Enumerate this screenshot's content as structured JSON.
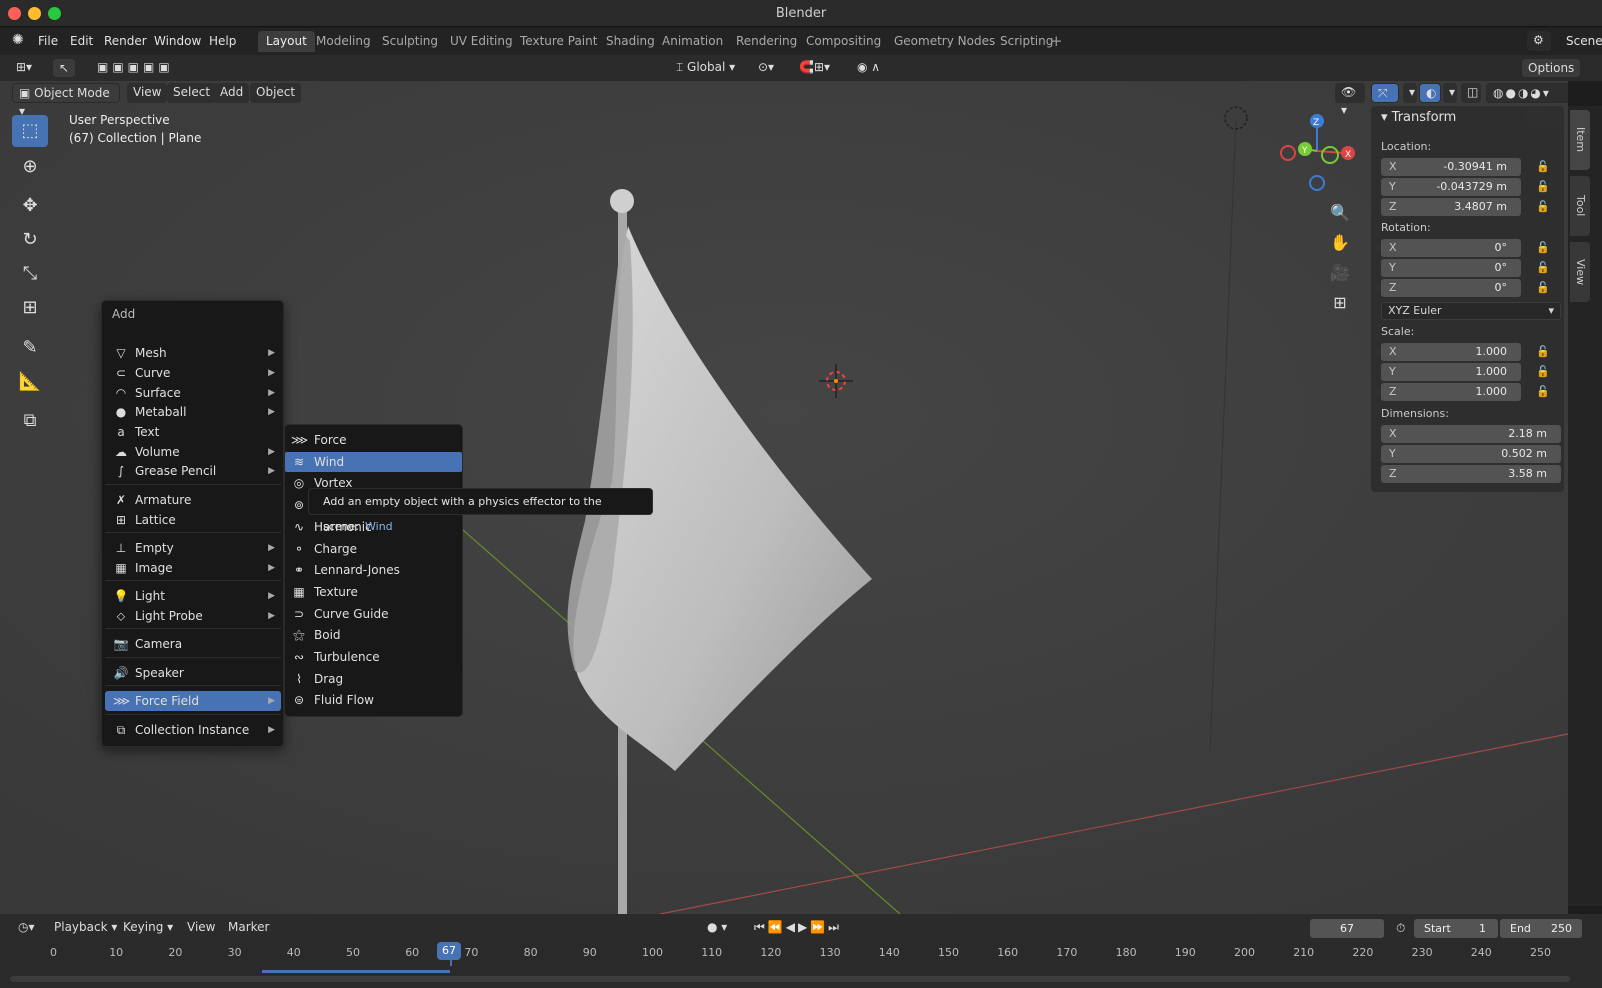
{
  "window": {
    "title": "Blender"
  },
  "menu": {
    "file": "File",
    "edit": "Edit",
    "render": "Render",
    "window": "Window",
    "help": "Help"
  },
  "workspaces": [
    "Layout",
    "Modeling",
    "Sculpting",
    "UV Editing",
    "Texture Paint",
    "Shading",
    "Animation",
    "Rendering",
    "Compositing",
    "Geometry Nodes",
    "Scripting"
  ],
  "active_workspace": "Layout",
  "scene_label": "Scene",
  "header": {
    "orientation": "Global",
    "options": "Options"
  },
  "viewport_header": {
    "mode": "Object Mode",
    "view": "View",
    "select": "Select",
    "add": "Add",
    "object": "Object"
  },
  "viewport": {
    "perspective": "User Perspective",
    "collection": "(67) Collection | Plane"
  },
  "gizmo": {
    "x": "X",
    "y": "Y",
    "z": "Z"
  },
  "npanel": {
    "title": "Transform",
    "location_label": "Location:",
    "location": [
      {
        "axis": "X",
        "value": "-0.30941 m"
      },
      {
        "axis": "Y",
        "value": "-0.043729 m"
      },
      {
        "axis": "Z",
        "value": "3.4807 m"
      }
    ],
    "rotation_label": "Rotation:",
    "rotation": [
      {
        "axis": "X",
        "value": "0°"
      },
      {
        "axis": "Y",
        "value": "0°"
      },
      {
        "axis": "Z",
        "value": "0°"
      }
    ],
    "rotation_mode": "XYZ Euler",
    "scale_label": "Scale:",
    "scale": [
      {
        "axis": "X",
        "value": "1.000"
      },
      {
        "axis": "Y",
        "value": "1.000"
      },
      {
        "axis": "Z",
        "value": "1.000"
      }
    ],
    "dimensions_label": "Dimensions:",
    "dimensions": [
      {
        "axis": "X",
        "value": "2.18 m"
      },
      {
        "axis": "Y",
        "value": "0.502 m"
      },
      {
        "axis": "Z",
        "value": "3.58 m"
      }
    ]
  },
  "sidetabs": {
    "item": "Item",
    "tool": "Tool",
    "view": "View"
  },
  "add_menu": {
    "title": "Add",
    "items": [
      "Mesh",
      "Curve",
      "Surface",
      "Metaball",
      "Text",
      "Volume",
      "Grease Pencil",
      "Armature",
      "Lattice",
      "Empty",
      "Image",
      "Light",
      "Light Probe",
      "Camera",
      "Speaker",
      "Force Field",
      "Collection Instance"
    ]
  },
  "force_field_menu": {
    "items": [
      "Force",
      "Wind",
      "Vortex",
      "Magnetic",
      "Harmonic",
      "Charge",
      "Lennard-Jones",
      "Texture",
      "Curve Guide",
      "Boid",
      "Turbulence",
      "Drag",
      "Fluid Flow"
    ]
  },
  "tooltip": {
    "text": "Add an empty object with a physics effector to the scene:",
    "operator": "Wind"
  },
  "timeline_header": {
    "playback": "Playback",
    "keying": "Keying",
    "view": "View",
    "marker": "Marker",
    "current_frame": "67",
    "start_label": "Start",
    "start": "1",
    "end_label": "End",
    "end": "250"
  },
  "timeline": {
    "ticks": [
      "0",
      "10",
      "20",
      "30",
      "40",
      "50",
      "60",
      "70",
      "80",
      "90",
      "100",
      "110",
      "120",
      "130",
      "140",
      "150",
      "160",
      "170",
      "180",
      "190",
      "200",
      "210",
      "220",
      "230",
      "240",
      "250"
    ],
    "playhead": "67"
  }
}
